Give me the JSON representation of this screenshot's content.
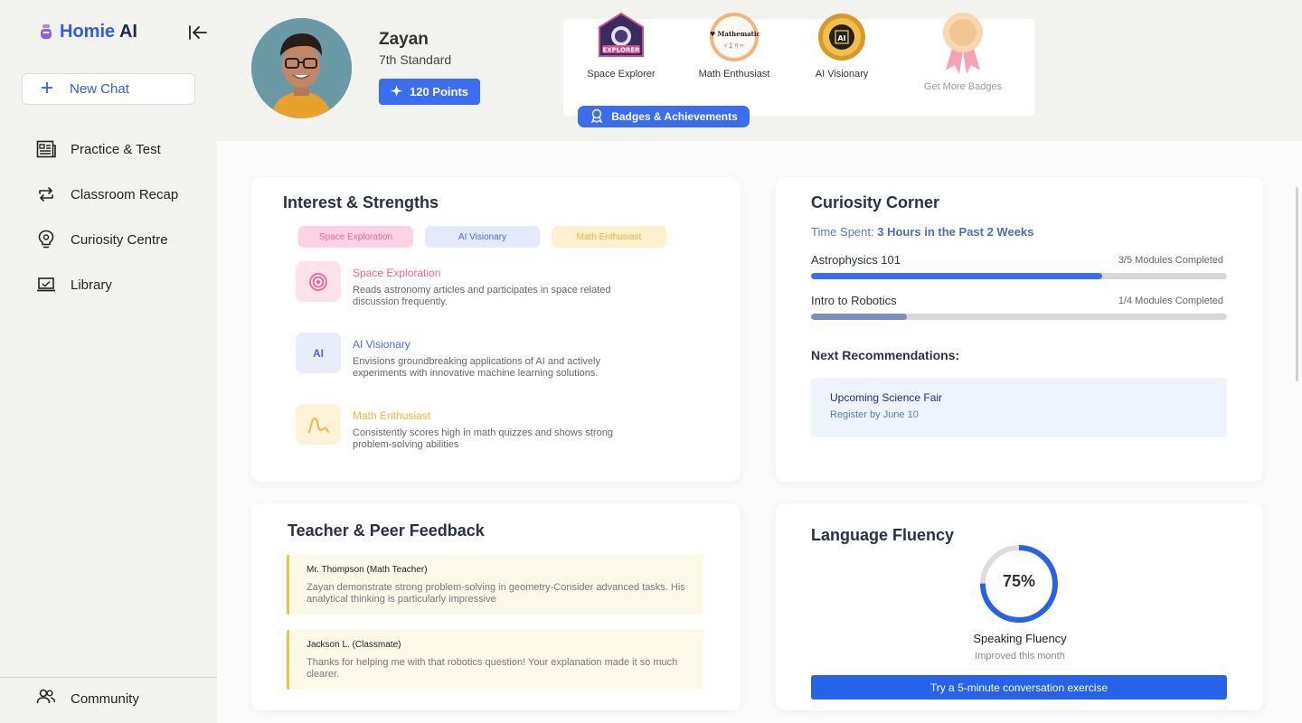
{
  "app": {
    "brand_name": "Homie",
    "brand_suffix": "AI"
  },
  "sidebar": {
    "new_chat_label": "New Chat",
    "items": [
      {
        "label": "Practice & Test",
        "icon": "newspaper-icon"
      },
      {
        "label": "Classroom Recap",
        "icon": "repeat-icon"
      },
      {
        "label": "Curiosity Centre",
        "icon": "lightbulb-icon"
      },
      {
        "label": "Library",
        "icon": "laptop-icon"
      }
    ],
    "community_label": "Community"
  },
  "profile": {
    "name": "Zayan",
    "grade": "7th Standard",
    "points_label": "120 Points"
  },
  "badges": {
    "items": [
      {
        "label": "Space Explorer",
        "art_text": "EXPLORER"
      },
      {
        "label": "Math Enthusiast",
        "art_text": "I ♥ Mathematics"
      },
      {
        "label": "AI Visionary",
        "art_text": "AI"
      }
    ],
    "more_label": "Get More Badges",
    "button_label": "Badges & Achievements"
  },
  "interests": {
    "title": "Interest & Strengths",
    "chips": [
      {
        "label": "Space Exploration",
        "bg": "#fbd3e4",
        "color": "#e8679b"
      },
      {
        "label": "AI Visionary",
        "bg": "#e4e9fb",
        "color": "#4b6bd6"
      },
      {
        "label": "Math Enthusiast",
        "bg": "#fdf0cf",
        "color": "#f0b43a"
      }
    ],
    "items": [
      {
        "title": "Space Exploration",
        "desc": "Reads astronomy articles and participates in space related discussion frequently.",
        "color": "#e8679b",
        "icon": "spiral-icon"
      },
      {
        "title": "AI Visionary",
        "desc": "Envisions groundbreaking applications of AI and actively experiments with innovative machine learning solutions.",
        "color": "#4b6bd6",
        "icon": "ai-icon",
        "icon_text": "AI"
      },
      {
        "title": "Math Enthusiast",
        "desc": "Consistently scores high in math quizzes and shows strong problem-solving abilities",
        "color": "#f0b43a",
        "icon": "wave-icon"
      }
    ]
  },
  "curiosity": {
    "title": "Curiosity Corner",
    "time_label": "Time Spent:",
    "time_value": "3 Hours in the Past 2 Weeks",
    "courses": [
      {
        "name": "Astrophysics 101",
        "status": "3/5 Modules Completed",
        "progress": 0.7,
        "color": "#3a6df0"
      },
      {
        "name": "Intro to Robotics",
        "status": "1/4 Modules Completed",
        "progress": 0.23,
        "color": "#7a8ebf"
      }
    ],
    "next_label": "Next Recommendations:",
    "recommendation": {
      "title": "Upcoming Science Fair",
      "subtitle": "Register by June 10"
    }
  },
  "feedback": {
    "title": "Teacher & Peer Feedback",
    "items": [
      {
        "author": "Mr. Thompson (Math Teacher)",
        "text": "Zayan demonstrate strong problem-solving in geometry-Consider advanced tasks. His analytical thinking is particularly impressive"
      },
      {
        "author": "Jackson L. (Classmate)",
        "text": "Thanks for helping me with that robotics question! Your explanation made it so much clearer."
      }
    ]
  },
  "fluency": {
    "title": "Language Fluency",
    "percent": 75,
    "percent_label": "75%",
    "label": "Speaking Fluency",
    "sublabel": "Improved this month",
    "button_label": "Try a 5-minute conversation exercise"
  }
}
